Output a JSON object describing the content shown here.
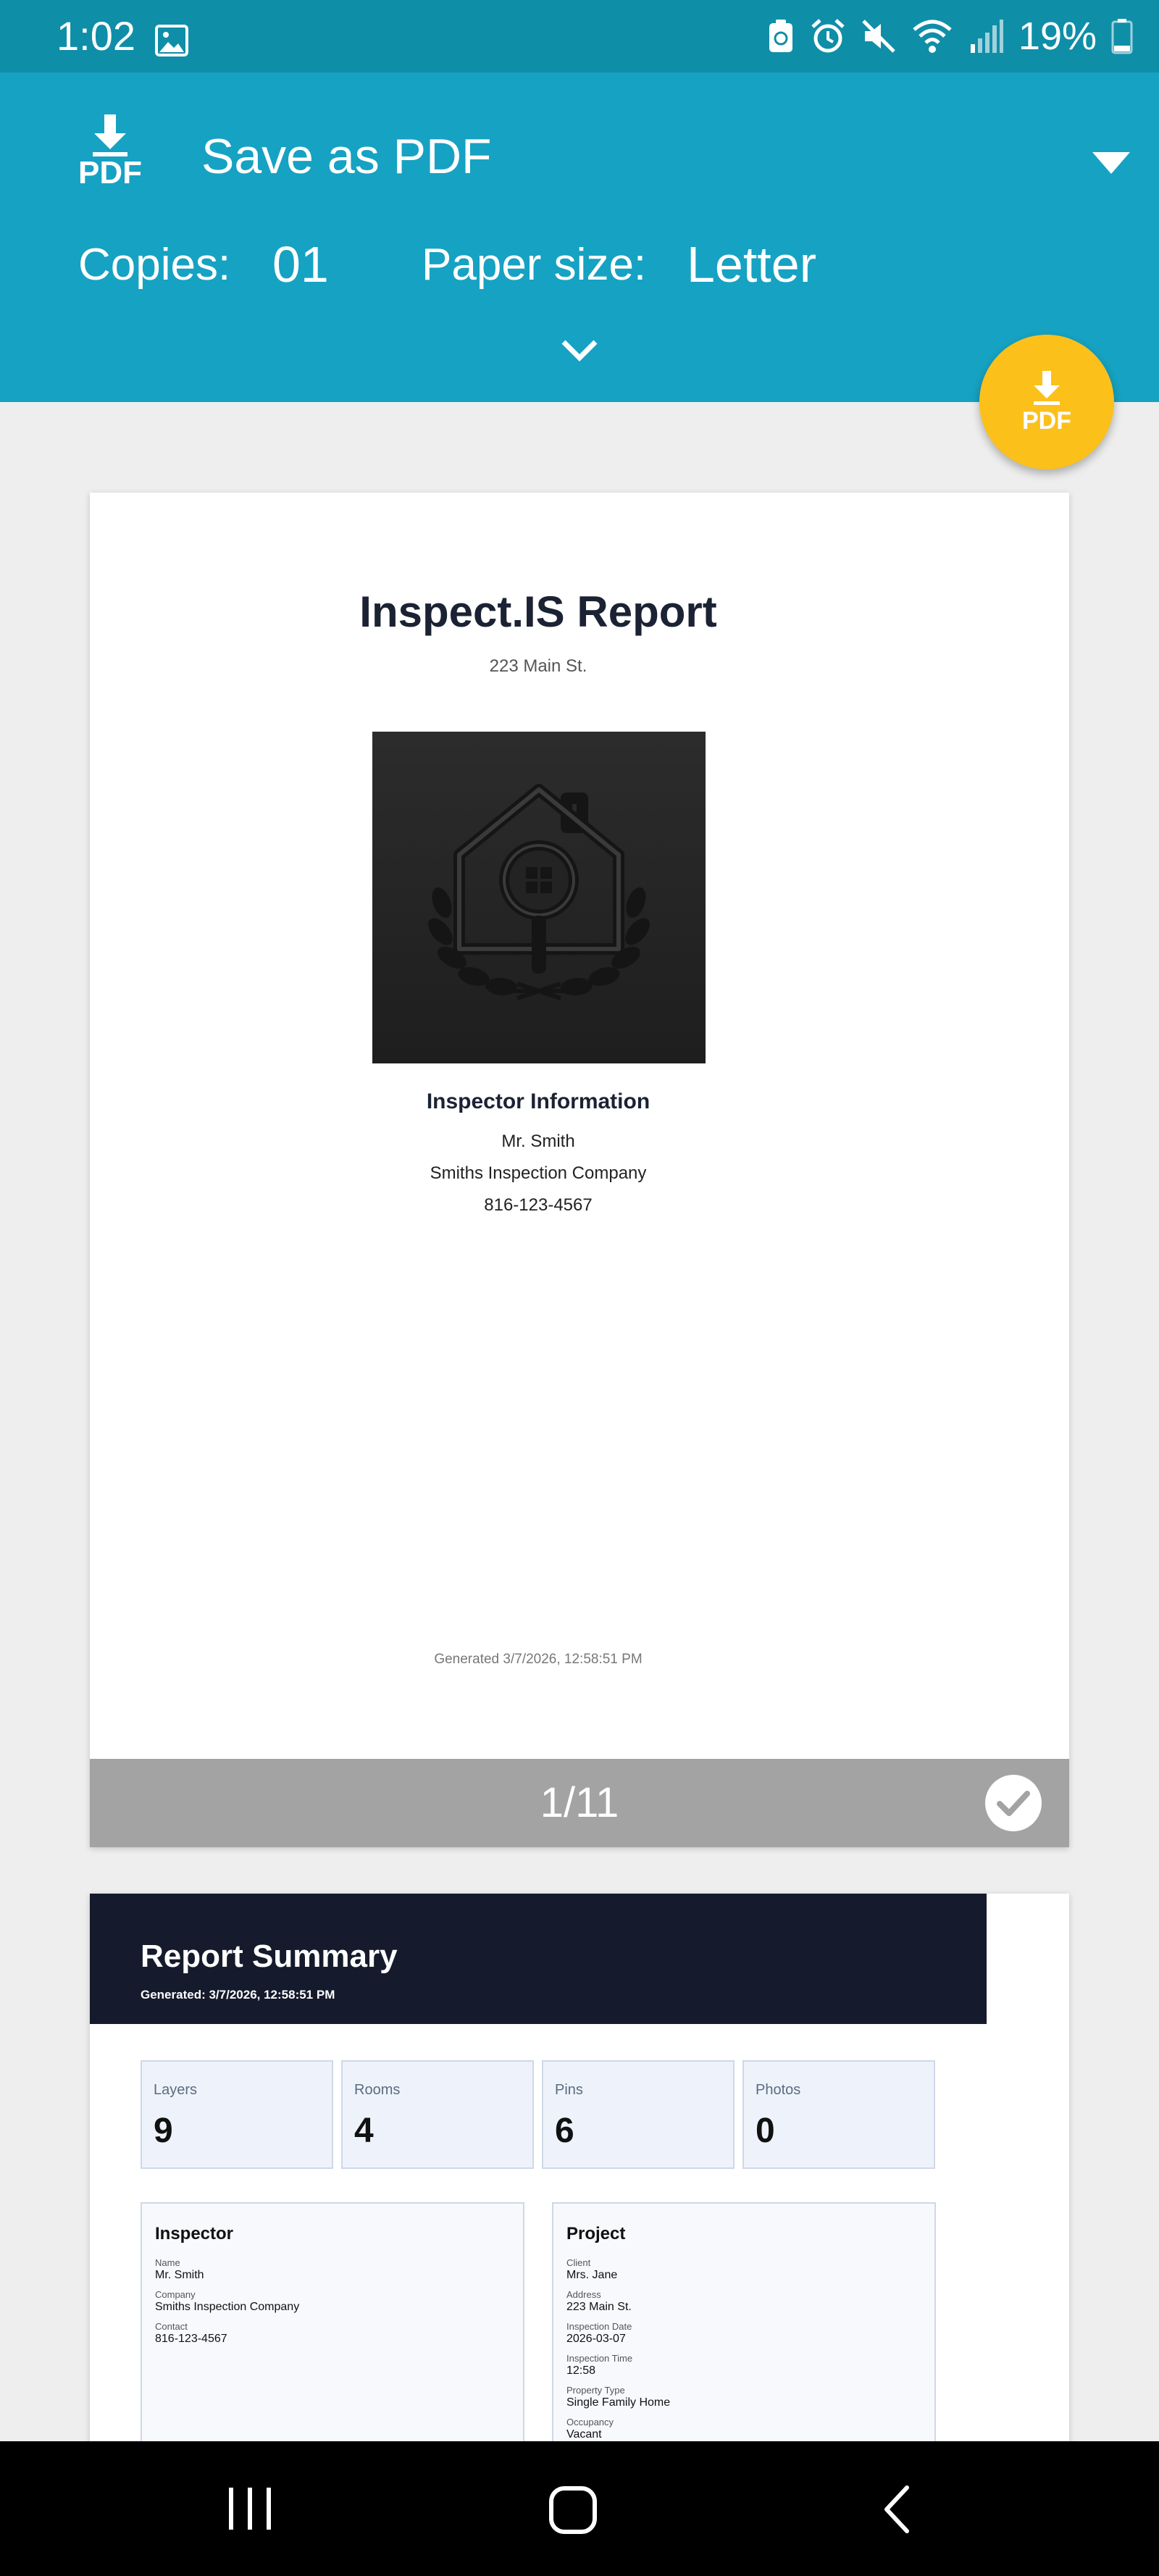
{
  "status_bar": {
    "time": "1:02",
    "battery": "19%"
  },
  "print_header": {
    "logo_text": "PDF",
    "destination": "Save as PDF",
    "copies_label": "Copies:",
    "copies_value": "01",
    "paper_size_label": "Paper size:",
    "paper_size_value": "Letter"
  },
  "fab": {
    "label": "PDF"
  },
  "page1": {
    "title": "Inspect.IS Report",
    "address": "223 Main St.",
    "inspector_title": "Inspector Information",
    "inspector_name": "Mr. Smith",
    "inspector_company": "Smiths Inspection Company",
    "inspector_phone": "816-123-4567",
    "generated": "Generated 3/7/2026, 12:58:51 PM",
    "page_indicator": "1/11"
  },
  "page2": {
    "title": "Report Summary",
    "generated": "Generated: 3/7/2026, 12:58:51 PM",
    "stats": [
      {
        "label": "Layers",
        "value": "9"
      },
      {
        "label": "Rooms",
        "value": "4"
      },
      {
        "label": "Pins",
        "value": "6"
      },
      {
        "label": "Photos",
        "value": "0"
      }
    ],
    "inspector_card": {
      "title": "Inspector",
      "fields": [
        {
          "label": "Name",
          "value": "Mr. Smith"
        },
        {
          "label": "Company",
          "value": "Smiths Inspection Company"
        },
        {
          "label": "Contact",
          "value": "816-123-4567"
        }
      ]
    },
    "project_card": {
      "title": "Project",
      "fields": [
        {
          "label": "Client",
          "value": "Mrs. Jane"
        },
        {
          "label": "Address",
          "value": "223 Main St."
        },
        {
          "label": "Inspection Date",
          "value": "2026-03-07"
        },
        {
          "label": "Inspection Time",
          "value": "12:58"
        },
        {
          "label": "Property Type",
          "value": "Single Family Home"
        },
        {
          "label": "Occupancy",
          "value": "Vacant"
        }
      ]
    }
  },
  "colors": {
    "status_bar": "#0f8ea8",
    "header": "#16a2c2",
    "fab": "#fcc01b",
    "summary_header": "#151b2c"
  }
}
